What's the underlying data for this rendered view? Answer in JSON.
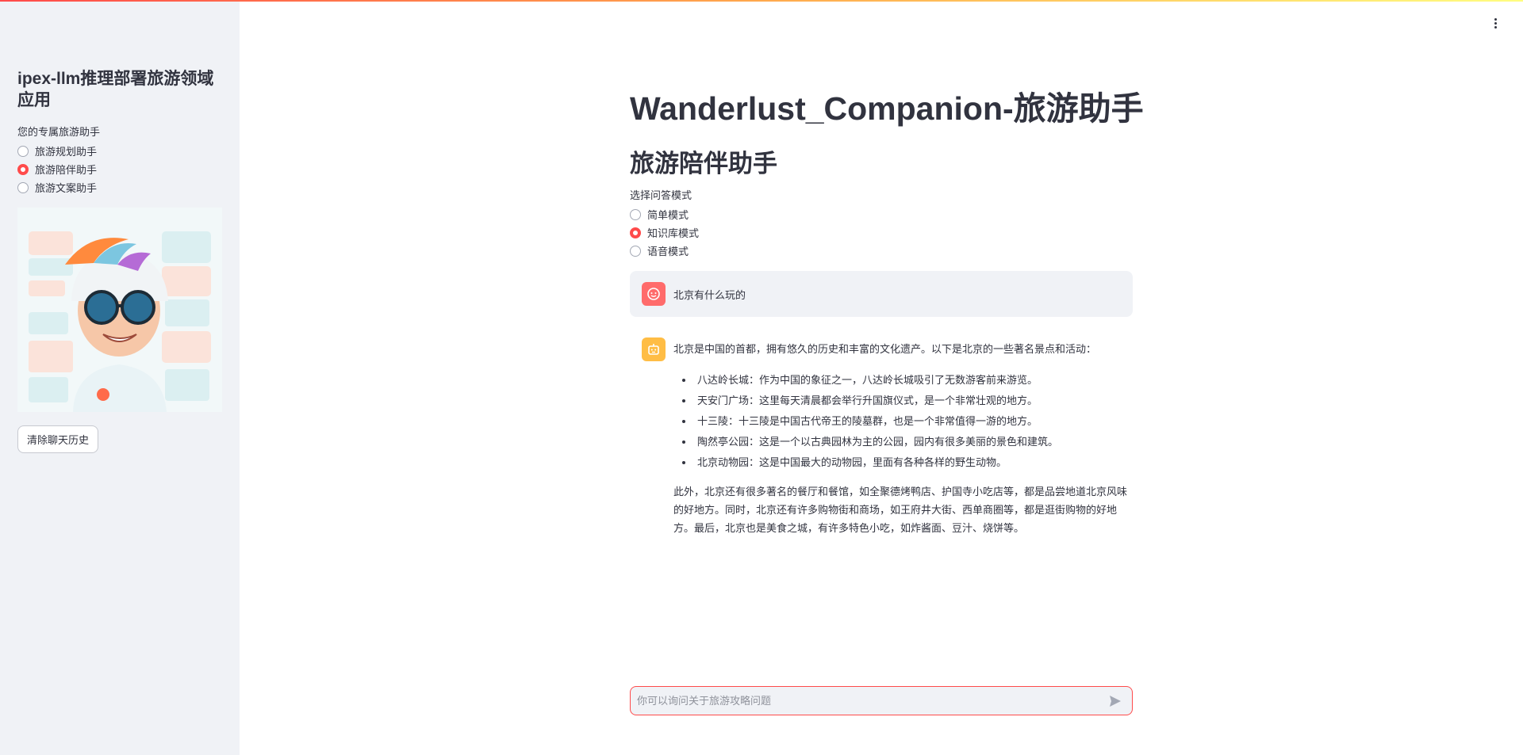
{
  "sidebar": {
    "title": "ipex-llm推理部署旅游领域应用",
    "radio_label": "您的专属旅游助手",
    "options": [
      {
        "label": "旅游规划助手",
        "checked": false
      },
      {
        "label": "旅游陪伴助手",
        "checked": true
      },
      {
        "label": "旅游文案助手",
        "checked": false
      }
    ],
    "clear_button": "清除聊天历史"
  },
  "main": {
    "title": "Wanderlust_Companion-旅游助手",
    "subtitle": "旅游陪伴助手",
    "mode_label": "选择问答模式",
    "modes": [
      {
        "label": "简单模式",
        "checked": false
      },
      {
        "label": "知识库模式",
        "checked": true
      },
      {
        "label": "语音模式",
        "checked": false
      }
    ]
  },
  "chat": {
    "user_message": "北京有什么玩的",
    "bot_intro": "北京是中国的首都，拥有悠久的历史和丰富的文化遗产。以下是北京的一些著名景点和活动：",
    "bot_items": [
      "八达岭长城：作为中国的象征之一，八达岭长城吸引了无数游客前来游览。",
      "天安门广场：这里每天清晨都会举行升国旗仪式，是一个非常壮观的地方。",
      "十三陵：十三陵是中国古代帝王的陵墓群，也是一个非常值得一游的地方。",
      "陶然亭公园：这是一个以古典园林为主的公园，园内有很多美丽的景色和建筑。",
      "北京动物园：这是中国最大的动物园，里面有各种各样的野生动物。"
    ],
    "bot_outro": "此外，北京还有很多著名的餐厅和餐馆，如全聚德烤鸭店、护国寺小吃店等，都是品尝地道北京风味的好地方。同时，北京还有许多购物街和商场，如王府井大街、西单商圈等，都是逛街购物的好地方。最后，北京也是美食之城，有许多特色小吃，如炸酱面、豆汁、烧饼等。",
    "input_placeholder": "你可以询问关于旅游攻略问题"
  },
  "colors": {
    "accent": "#ff4b4b",
    "sidebar_bg": "#f0f2f6",
    "user_avatar": "#ff6b6b",
    "bot_avatar": "#ffbd45"
  },
  "icons": [
    "menu-icon",
    "user-avatar-icon",
    "bot-avatar-icon",
    "send-icon"
  ]
}
